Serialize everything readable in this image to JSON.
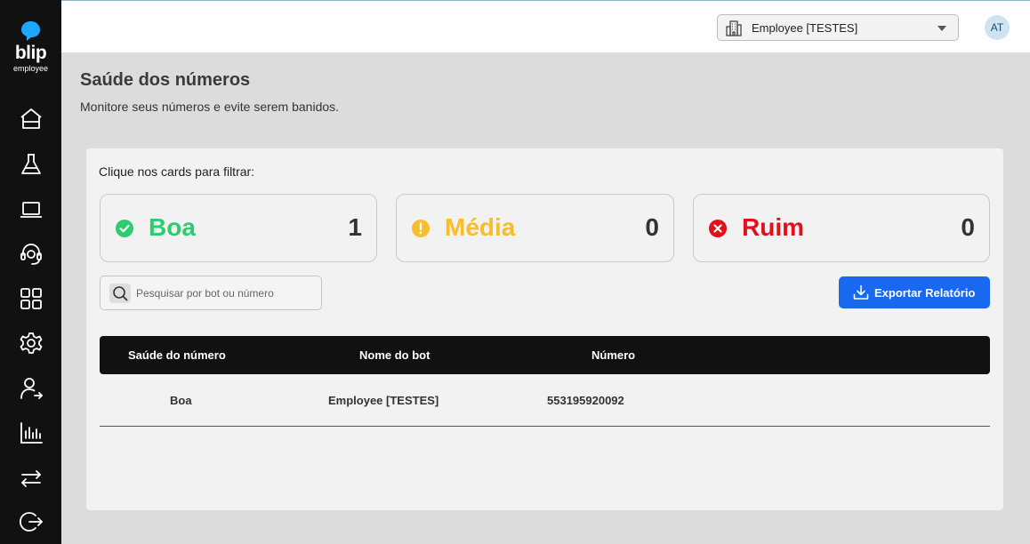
{
  "brand": {
    "name": "blip",
    "subtitle": "employee"
  },
  "sidebar": {
    "items": [
      {
        "icon": "home-icon"
      },
      {
        "icon": "flask-icon"
      },
      {
        "icon": "laptop-icon"
      },
      {
        "icon": "headset-icon"
      },
      {
        "icon": "apps-grid-icon"
      },
      {
        "icon": "gear-icon"
      },
      {
        "icon": "user-transfer-icon"
      },
      {
        "icon": "bar-chart-icon"
      },
      {
        "icon": "swap-arrows-icon"
      },
      {
        "icon": "logout-icon"
      }
    ]
  },
  "header": {
    "bot_selector": {
      "value": "Employee [TESTES]",
      "icon": "building-icon"
    },
    "avatar_initials": "AT"
  },
  "page": {
    "title": "Saúde dos números",
    "subtitle": "Monitore seus números e evite serem banidos."
  },
  "filters": {
    "label": "Clique nos cards para filtrar:",
    "cards": [
      {
        "label": "Boa",
        "count": "1",
        "color": "#2ecc71",
        "icon": "check-circle-icon"
      },
      {
        "label": "Média",
        "count": "0",
        "color": "#f7bd2a",
        "icon": "alert-circle-icon"
      },
      {
        "label": "Ruim",
        "count": "0",
        "color": "#e0111c",
        "icon": "x-circle-icon"
      }
    ]
  },
  "search": {
    "placeholder": "Pesquisar por bot ou número",
    "value": ""
  },
  "export_button": {
    "label": "Exportar Relatório",
    "color": "#1968f0"
  },
  "table": {
    "headers": [
      "Saúde do número",
      "Nome do bot",
      "Número"
    ],
    "rows": [
      [
        "Boa",
        "Employee [TESTES]",
        "553195920092"
      ]
    ]
  }
}
